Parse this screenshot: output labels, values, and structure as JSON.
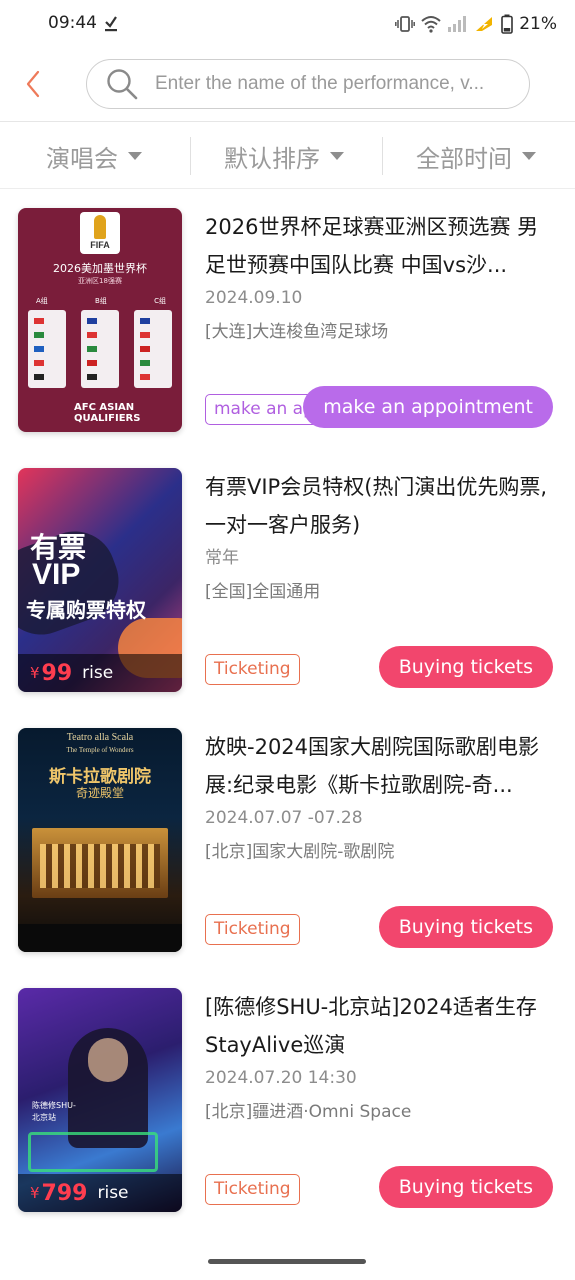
{
  "status_bar": {
    "time": "09:44",
    "battery": "21%",
    "icons": [
      "download-done-icon",
      "vibrate-icon",
      "wifi-icon",
      "signal-icon",
      "charging-icon",
      "battery-icon"
    ]
  },
  "header": {
    "back_icon": "chevron-left-icon",
    "search": {
      "icon": "search-icon",
      "placeholder": "Enter the name of the performance, v..."
    }
  },
  "filters": [
    {
      "label": "演唱会"
    },
    {
      "label": "默认排序"
    },
    {
      "label": "全部时间"
    }
  ],
  "events": [
    {
      "title": "2026世界杯足球赛亚洲区预选赛 男足世预赛中国队比赛 中国vs沙...",
      "date": "2024.09.10",
      "venue": "[大连]大连梭鱼湾足球场",
      "tag": "make an ap",
      "action": "make an appointment",
      "poster": {
        "top": "FIFA",
        "line1": "2026美加墨世界杯",
        "line2": "亚洲区18强赛",
        "groups": [
          "A组",
          "B组",
          "C组"
        ],
        "bottom": "AFC ASIAN QUALIFIERS"
      }
    },
    {
      "title": "有票VIP会员特权(热门演出优先购票,一对一客户服务)",
      "date": "常年",
      "venue": "[全国]全国通用",
      "tag": "Ticketing",
      "action": "Buying tickets",
      "poster": {
        "line1": "有票",
        "line2": "VIP",
        "line3": "专属购票特权",
        "price": "99",
        "suffix": "rise"
      }
    },
    {
      "title": "放映-2024国家大剧院国际歌剧电影展:纪录电影《斯卡拉歌剧院-奇...",
      "date": "2024.07.07 -07.28",
      "venue": "[北京]国家大剧院-歌剧院",
      "tag": "Ticketing",
      "action": "Buying tickets",
      "poster": {
        "line1": "Teatro alla Scala",
        "line2": "The Temple of Wonders",
        "line3": "斯卡拉歌剧院",
        "line4": "奇迹殿堂"
      }
    },
    {
      "title": "[陈德修SHU-北京站]2024适者生存StayAlive巡演",
      "date": "2024.07.20 14:30",
      "venue": "[北京]疆进酒·Omni Space",
      "tag": "Ticketing",
      "action": "Buying tickets",
      "poster": {
        "line1": "陈德修SHU-",
        "line2": "北京站",
        "price": "799",
        "suffix": "rise"
      }
    }
  ],
  "colors": {
    "accent": "#f2466d",
    "tag_orange": "#e8704f",
    "appointment_purple": "#b96bea"
  }
}
